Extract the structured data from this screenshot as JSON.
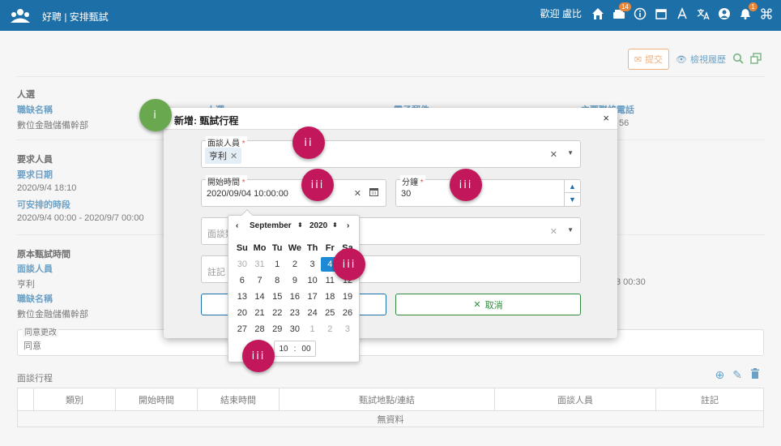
{
  "topbar": {
    "brand": "好聘 | 安排甄試",
    "welcome": "歡迎 盧比",
    "mail_badge": "14",
    "bell_badge": "1",
    "icons": [
      "home-icon",
      "mailbox-icon",
      "info-icon",
      "window-icon",
      "font-icon",
      "translate-icon",
      "user-icon",
      "bell-icon",
      "command-icon"
    ]
  },
  "toolbar": {
    "submit_label": "提交",
    "history_label": "檢視履歷"
  },
  "section1": {
    "title": "人選",
    "job_label": "職缺名稱",
    "job_value": "數位金融儲備幹部",
    "col2_label": "人選",
    "col3_label": "電子郵件",
    "col4_label": "主要聯絡電話",
    "col4_value": "56"
  },
  "section2": {
    "title": "要求人員",
    "date_label": "要求日期",
    "date_value": "2020/9/4 18:10",
    "slot_label": "可安排的時段",
    "slot_value": "2020/9/4 00:00 - 2020/9/7 00:00"
  },
  "section3": {
    "title": "原本甄試時間",
    "interviewer_label": "面談人員",
    "interviewer_value": "亨利",
    "job_label": "職缺名稱",
    "job_value": "數位金融儲備幹部",
    "right_value": "3 00:30"
  },
  "consent": {
    "legend": "同意更改",
    "value": "同意"
  },
  "schedule_table": {
    "title": "面談行程",
    "columns": [
      "",
      "類別",
      "開始時間",
      "結束時間",
      "甄試地點/連結",
      "面談人員",
      "註記"
    ],
    "empty_text": "無資料"
  },
  "modal": {
    "title": "新增: 甄試行程",
    "close": "×",
    "interviewer_label": "面談人員",
    "interviewer_chip": "亨利",
    "start_label": "開始時間",
    "start_value": "2020/09/04 10:00:00",
    "minutes_label": "分鐘",
    "minutes_value": "30",
    "third_placeholder": "面談類",
    "note_placeholder": "註記",
    "cancel_label": "取消"
  },
  "datepicker": {
    "month": "September",
    "year": "2020",
    "weekdays": [
      "Su",
      "Mo",
      "Tu",
      "We",
      "Th",
      "Fr",
      "Sa"
    ],
    "weeks": [
      [
        "30",
        "31",
        "1",
        "2",
        "3",
        "4",
        "5"
      ],
      [
        "6",
        "7",
        "8",
        "9",
        "10",
        "11",
        "12"
      ],
      [
        "13",
        "14",
        "15",
        "16",
        "17",
        "18",
        "19"
      ],
      [
        "20",
        "21",
        "22",
        "23",
        "24",
        "25",
        "26"
      ],
      [
        "27",
        "28",
        "29",
        "30",
        "1",
        "2",
        "3"
      ]
    ],
    "selected": "4",
    "hour": "10",
    "minute": "00"
  },
  "markers": {
    "m1": "i",
    "m2": "ii",
    "m3": "iii"
  }
}
